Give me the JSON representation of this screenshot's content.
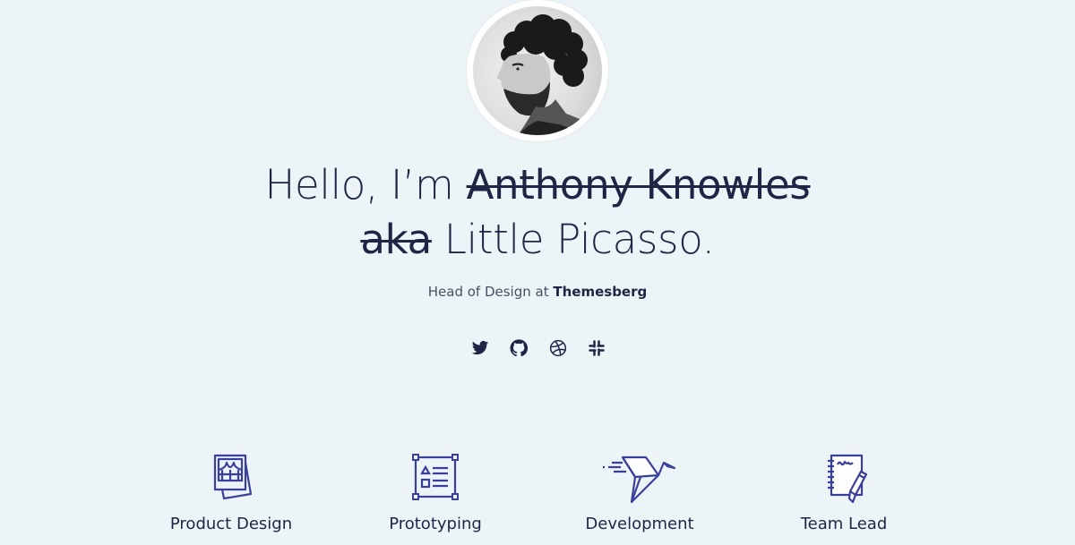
{
  "profile": {
    "avatar_alt": "Portrait of Anthony Knowles"
  },
  "headline": {
    "prefix": "Hello, I’m ",
    "struck_name": "Anthony Knowles",
    "struck_aka": "aka",
    "nickname": " Little Picasso."
  },
  "subtitle": {
    "role": "Head of Design at ",
    "company": "Themesberg"
  },
  "socials": [
    {
      "name": "Twitter",
      "icon": "twitter-icon"
    },
    {
      "name": "GitHub",
      "icon": "github-icon"
    },
    {
      "name": "Dribbble",
      "icon": "dribbble-icon"
    },
    {
      "name": "Slack",
      "icon": "slack-icon"
    }
  ],
  "features": [
    {
      "label": "Product Design",
      "icon": "photos-icon"
    },
    {
      "label": "Prototyping",
      "icon": "wireframe-icon"
    },
    {
      "label": "Development",
      "icon": "origami-bird-icon"
    },
    {
      "label": "Team Lead",
      "icon": "notebook-pencil-icon"
    }
  ],
  "colors": {
    "background": "#ecf4f7",
    "text": "#1f2544",
    "accent": "#3a3f9b"
  }
}
